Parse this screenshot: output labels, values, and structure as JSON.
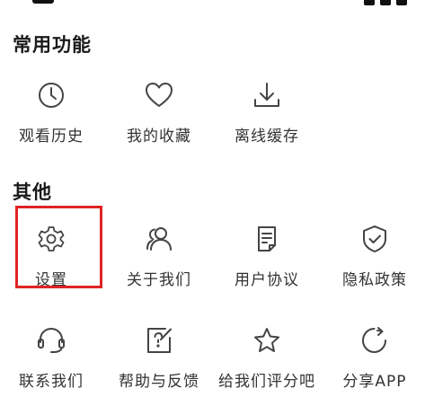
{
  "sections": {
    "common": {
      "title": "常用功能",
      "items": [
        {
          "label": "观看历史",
          "icon": "clock-icon"
        },
        {
          "label": "我的收藏",
          "icon": "heart-icon"
        },
        {
          "label": "离线缓存",
          "icon": "download-icon"
        }
      ]
    },
    "other": {
      "title": "其他",
      "items": [
        {
          "label": "设置",
          "icon": "gear-icon"
        },
        {
          "label": "关于我们",
          "icon": "users-icon"
        },
        {
          "label": "用户协议",
          "icon": "document-icon"
        },
        {
          "label": "隐私政策",
          "icon": "shield-check-icon"
        },
        {
          "label": "联系我们",
          "icon": "headset-icon"
        },
        {
          "label": "帮助与反馈",
          "icon": "help-edit-icon"
        },
        {
          "label": "给我们评分吧",
          "icon": "star-icon"
        },
        {
          "label": "分享APP",
          "icon": "share-refresh-icon"
        }
      ]
    }
  },
  "highlight": {
    "color": "#e02424",
    "target": "设置"
  },
  "colors": {
    "icon": "#444444",
    "text": "#333333",
    "title": "#1a1a1a",
    "background": "#ffffff"
  }
}
